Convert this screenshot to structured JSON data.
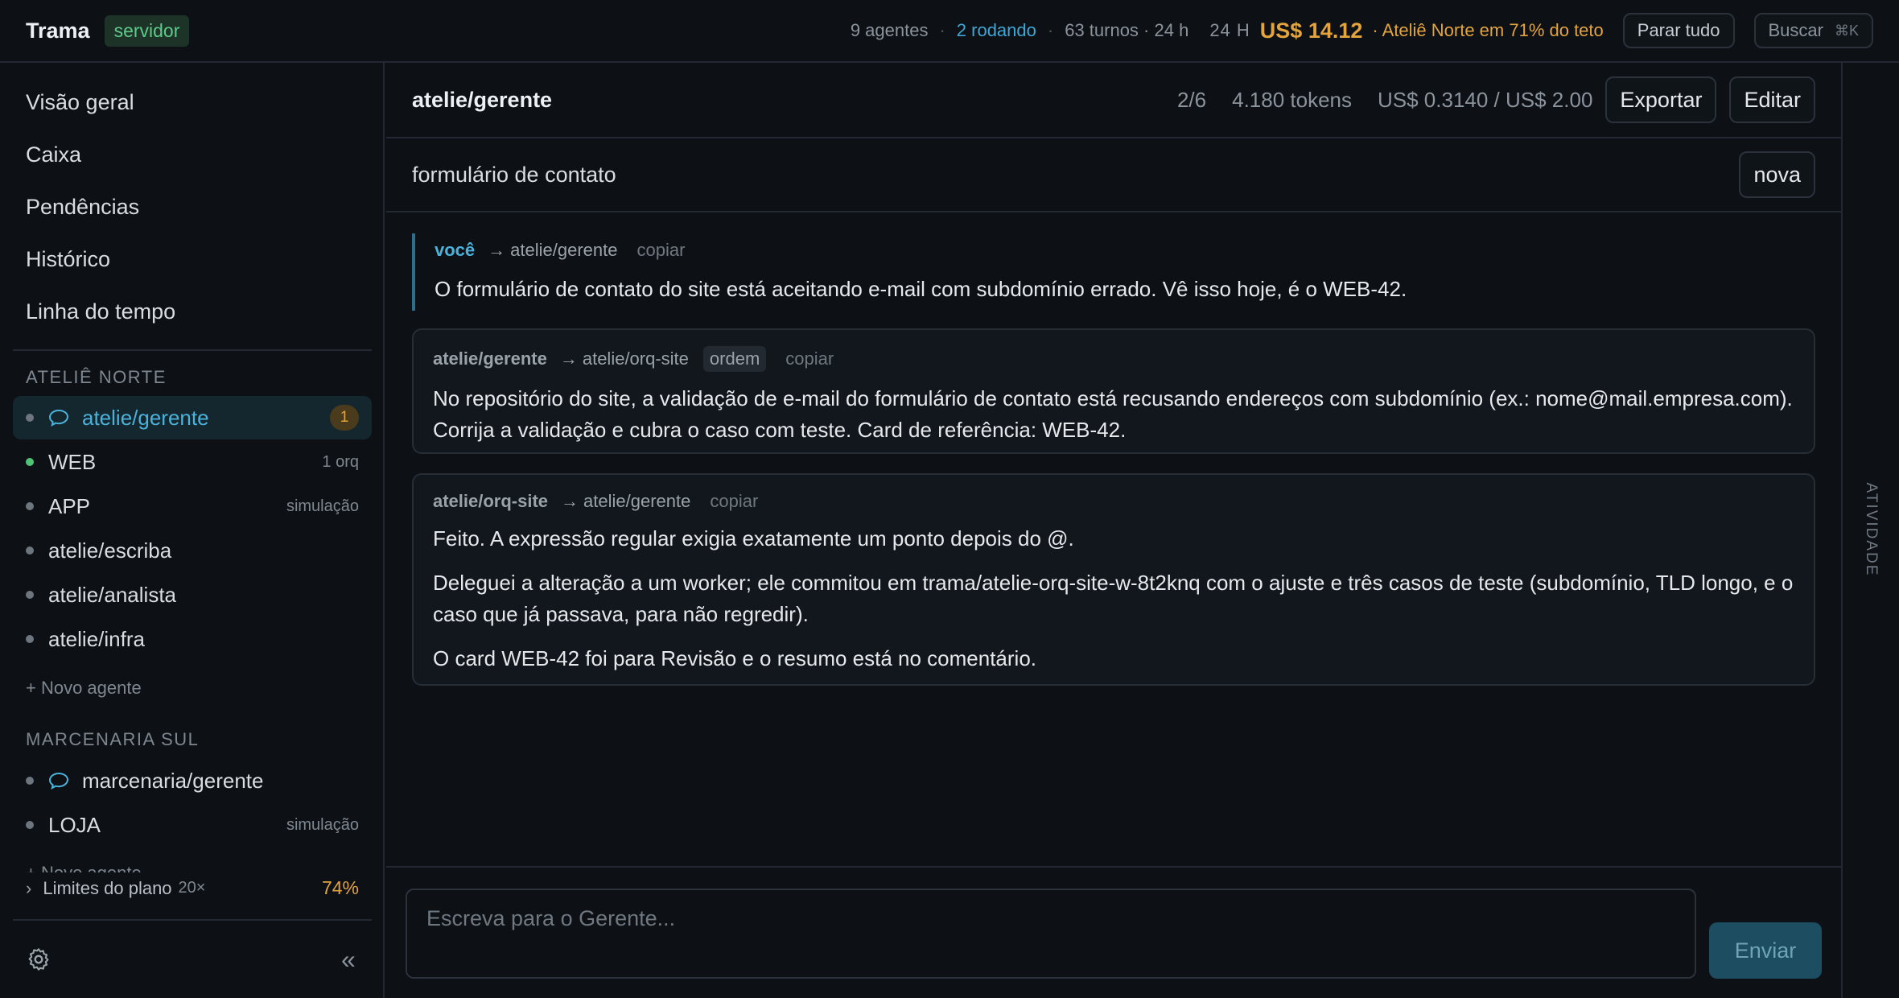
{
  "topbar": {
    "brand": "Trama",
    "server_badge": "servidor",
    "agents": "9 agentes",
    "running": "2 rodando",
    "turns": "63 turnos · 24 h",
    "period": "24 H",
    "cost": "US$ 14.12",
    "warning": "· Ateliê Norte em 71% do teto",
    "stop_all": "Parar tudo",
    "search": "Buscar",
    "search_shortcut": "⌘K"
  },
  "sidebar": {
    "nav": [
      "Visão geral",
      "Caixa",
      "Pendências",
      "Histórico",
      "Linha do tempo"
    ],
    "sections": [
      {
        "title": "ATELIÊ NORTE",
        "agents": [
          {
            "name": "atelie/gerente",
            "status": "idle",
            "chat_icon": true,
            "badge": "1",
            "meta": "",
            "active": true
          },
          {
            "name": "WEB",
            "status": "running",
            "chat_icon": false,
            "badge": "",
            "meta": "1 orq",
            "active": false
          },
          {
            "name": "APP",
            "status": "idle",
            "chat_icon": false,
            "badge": "",
            "meta": "simulação",
            "active": false
          },
          {
            "name": "atelie/escriba",
            "status": "idle",
            "chat_icon": false,
            "badge": "",
            "meta": "",
            "active": false
          },
          {
            "name": "atelie/analista",
            "status": "idle",
            "chat_icon": false,
            "badge": "",
            "meta": "",
            "active": false
          },
          {
            "name": "atelie/infra",
            "status": "idle",
            "chat_icon": false,
            "badge": "",
            "meta": "",
            "active": false
          }
        ],
        "new_agent": "+ Novo agente"
      },
      {
        "title": "MARCENARIA SUL",
        "agents": [
          {
            "name": "marcenaria/gerente",
            "status": "idle",
            "chat_icon": true,
            "badge": "",
            "meta": "",
            "active": false
          },
          {
            "name": "LOJA",
            "status": "idle",
            "chat_icon": false,
            "badge": "",
            "meta": "simulação",
            "active": false
          }
        ],
        "new_agent": "+ Novo agente"
      }
    ],
    "plan": {
      "label": "Limites do plano",
      "multiplier": "20×",
      "usage": "74%"
    }
  },
  "conversation": {
    "title": "atelie/gerente",
    "position": "2/6",
    "tokens": "4.180 tokens",
    "budget": "US$ 0.3140 / US$ 2.00",
    "export_label": "Exportar",
    "edit_label": "Editar",
    "subject": "formulário de contato",
    "new_label": "nova",
    "messages": [
      {
        "from": "você",
        "to": "atelie/gerente",
        "tag": "",
        "copy": "copiar",
        "paragraphs": [
          "O formulário de contato do site está aceitando e-mail com subdomínio errado. Vê isso hoje, é o WEB-42."
        ]
      },
      {
        "from": "atelie/gerente",
        "to": "atelie/orq-site",
        "tag": "ordem",
        "copy": "copiar",
        "paragraphs": [
          "No repositório do site, a validação de e-mail do formulário de contato está recusando endereços com subdomínio (ex.: nome@mail.empresa.com). Corrija a validação e cubra o caso com teste. Card de referência: WEB-42."
        ]
      },
      {
        "from": "atelie/orq-site",
        "to": "atelie/gerente",
        "tag": "",
        "copy": "copiar",
        "paragraphs": [
          "Feito. A expressão regular exigia exatamente um ponto depois do @.",
          "Deleguei a alteração a um worker; ele commitou em trama/atelie-orq-site-w-8t2knq com o ajuste e três casos de teste (subdomínio, TLD longo, e o caso que já passava, para não regredir).",
          "O card WEB-42 foi para Revisão e o resumo está no comentário."
        ]
      }
    ],
    "composer_placeholder": "Escreva para o Gerente...",
    "send_label": "Enviar"
  },
  "activity": {
    "label": "ATIVIDADE"
  },
  "colors": {
    "accent": "#4ab2db",
    "warning": "#e3a33d",
    "running": "#4fc477",
    "background": "#0d1116"
  }
}
